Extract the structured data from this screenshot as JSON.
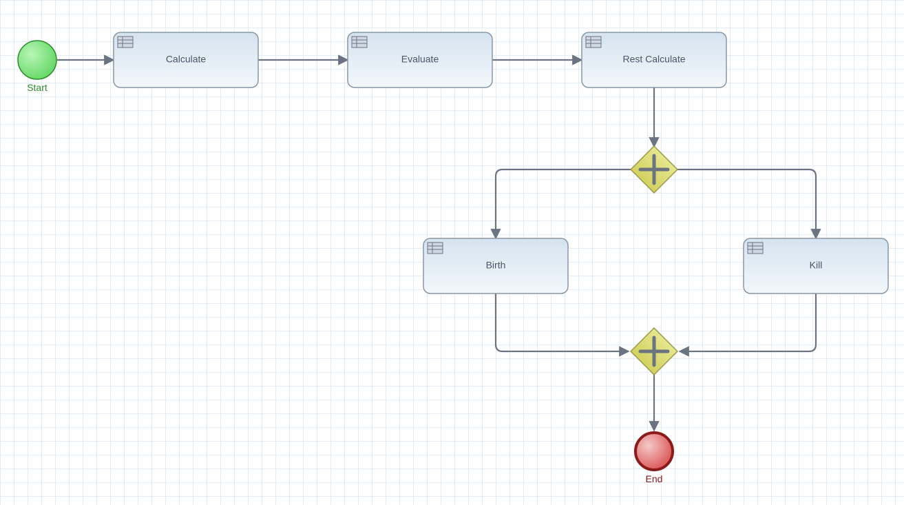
{
  "nodes": {
    "start": {
      "label": "Start",
      "labelColor": "#2d8a2d"
    },
    "calculate": {
      "label": "Calculate"
    },
    "evaluate": {
      "label": "Evaluate"
    },
    "restCalculate": {
      "label": "Rest Calculate"
    },
    "birth": {
      "label": "Birth"
    },
    "kill": {
      "label": "Kill"
    },
    "end": {
      "label": "End",
      "labelColor": "#8b1a1a"
    }
  },
  "colors": {
    "taskFillTop": "#d5e3ef",
    "taskFillBottom": "#f3f7fb",
    "taskStroke": "#8896a6",
    "flowStroke": "#6b7280",
    "startFillTop": "#7fe87f",
    "startFillBottom": "#d6f8d6",
    "startStroke": "#2d8a2d",
    "endFillTop": "#e36a6a",
    "endFillBottom": "#f5c9c9",
    "endStroke": "#8b1a1a",
    "gatewayFillTop": "#d8d86a",
    "gatewayFillBottom": "#f0f0c0",
    "gatewayStroke": "#9a9a4a"
  }
}
